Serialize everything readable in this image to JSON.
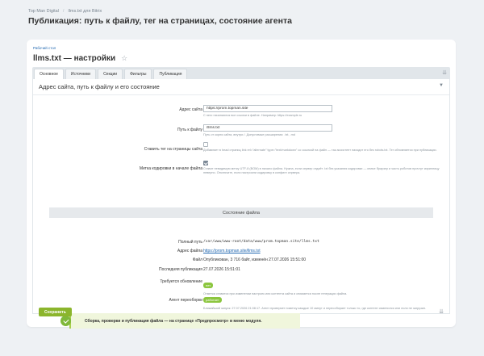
{
  "breadcrumbs": [
    "Top Man Digital",
    "llms.txt для Bitrix"
  ],
  "page_title": "Публикация: путь к файлу, тег на страницах, состояние агента",
  "card": {
    "sublink": "Рабочий стол",
    "heading": "llms.txt — настройки"
  },
  "tabs": [
    {
      "label": "Основное",
      "active": true
    },
    {
      "label": "Источники",
      "active": false
    },
    {
      "label": "Секции",
      "active": false
    },
    {
      "label": "Фильтры",
      "active": false
    },
    {
      "label": "Публикация",
      "active": false
    }
  ],
  "section": {
    "title": "Адрес сайта, путь к файлу и его состояние"
  },
  "form": {
    "site_url": {
      "label": "Адрес сайта",
      "value": "https://prom.topman.site",
      "hint": "С него начинаются все ссылки в файле. Например: https://example.ru"
    },
    "file_path": {
      "label": "Путь к файлу",
      "value": "/llms.txt",
      "hint": "Путь от корня сайта, внутри /. Допустимые расширения: .txt, .md"
    },
    "page_tag": {
      "label": "Ставить тег на страницы сайта",
      "checked": false,
      "hint": "Добавляет в head страниц link rel=\"alternate\" type=\"text/markdown\" со ссылкой на файл — так ассистент находит его без robots.txt. Тег обновляется при публикации."
    },
    "bom_mark": {
      "label": "Метка кодировки в начале файла",
      "checked": true,
      "hint": "Ставит невидимую метку UTF-8 (BOM) в начало файла. Нужна, если сервер отдаёт .txt без указания кодировки — иначе браузер и часть роботов прочтут кириллицу неверно. Отключите, если настроили кодировку в конфиге сервера."
    }
  },
  "status": {
    "title": "Состояние файла",
    "full_path_label": "Полный путь",
    "full_path": "/var/www/www-root/data/www/prom.topman.site/llms.txt",
    "file_url_label": "Адрес файла",
    "file_url": "https://prom.topman.site/llms.txt",
    "file_label": "Файл",
    "file_info": "Опубликован, 3 716 байт, изменён 27.07.2026 15:51:00",
    "last_pub_label": "Последняя публикация",
    "last_pub": "27.07.2026 15:51:01",
    "update_label": "Требуется обновление",
    "update_badge": "нет",
    "update_hint": "Отметка ставится при изменении настроек или контента сайта и снимается после генерации файла.",
    "agent_label": "Агент переоборки",
    "agent_badge": "работает",
    "agent_hint": "Ближайший запуск: 27.07.2026 21:08:17. Агент проверяет пометку каждые 10 минут и пересобирает только то, где контент изменился или если не загрузил."
  },
  "note": "Сборка, проверки и публикация файла — на странице «Предпросмотр» в меню модуля.",
  "save_label": "Сохранить",
  "colors": {
    "accent": "#8bb52c",
    "link": "#2067b0",
    "note_bg": "#f0f6dc"
  },
  "icons": [
    "star-icon",
    "pin-icon",
    "chevron-down-icon",
    "check-circle-icon"
  ]
}
